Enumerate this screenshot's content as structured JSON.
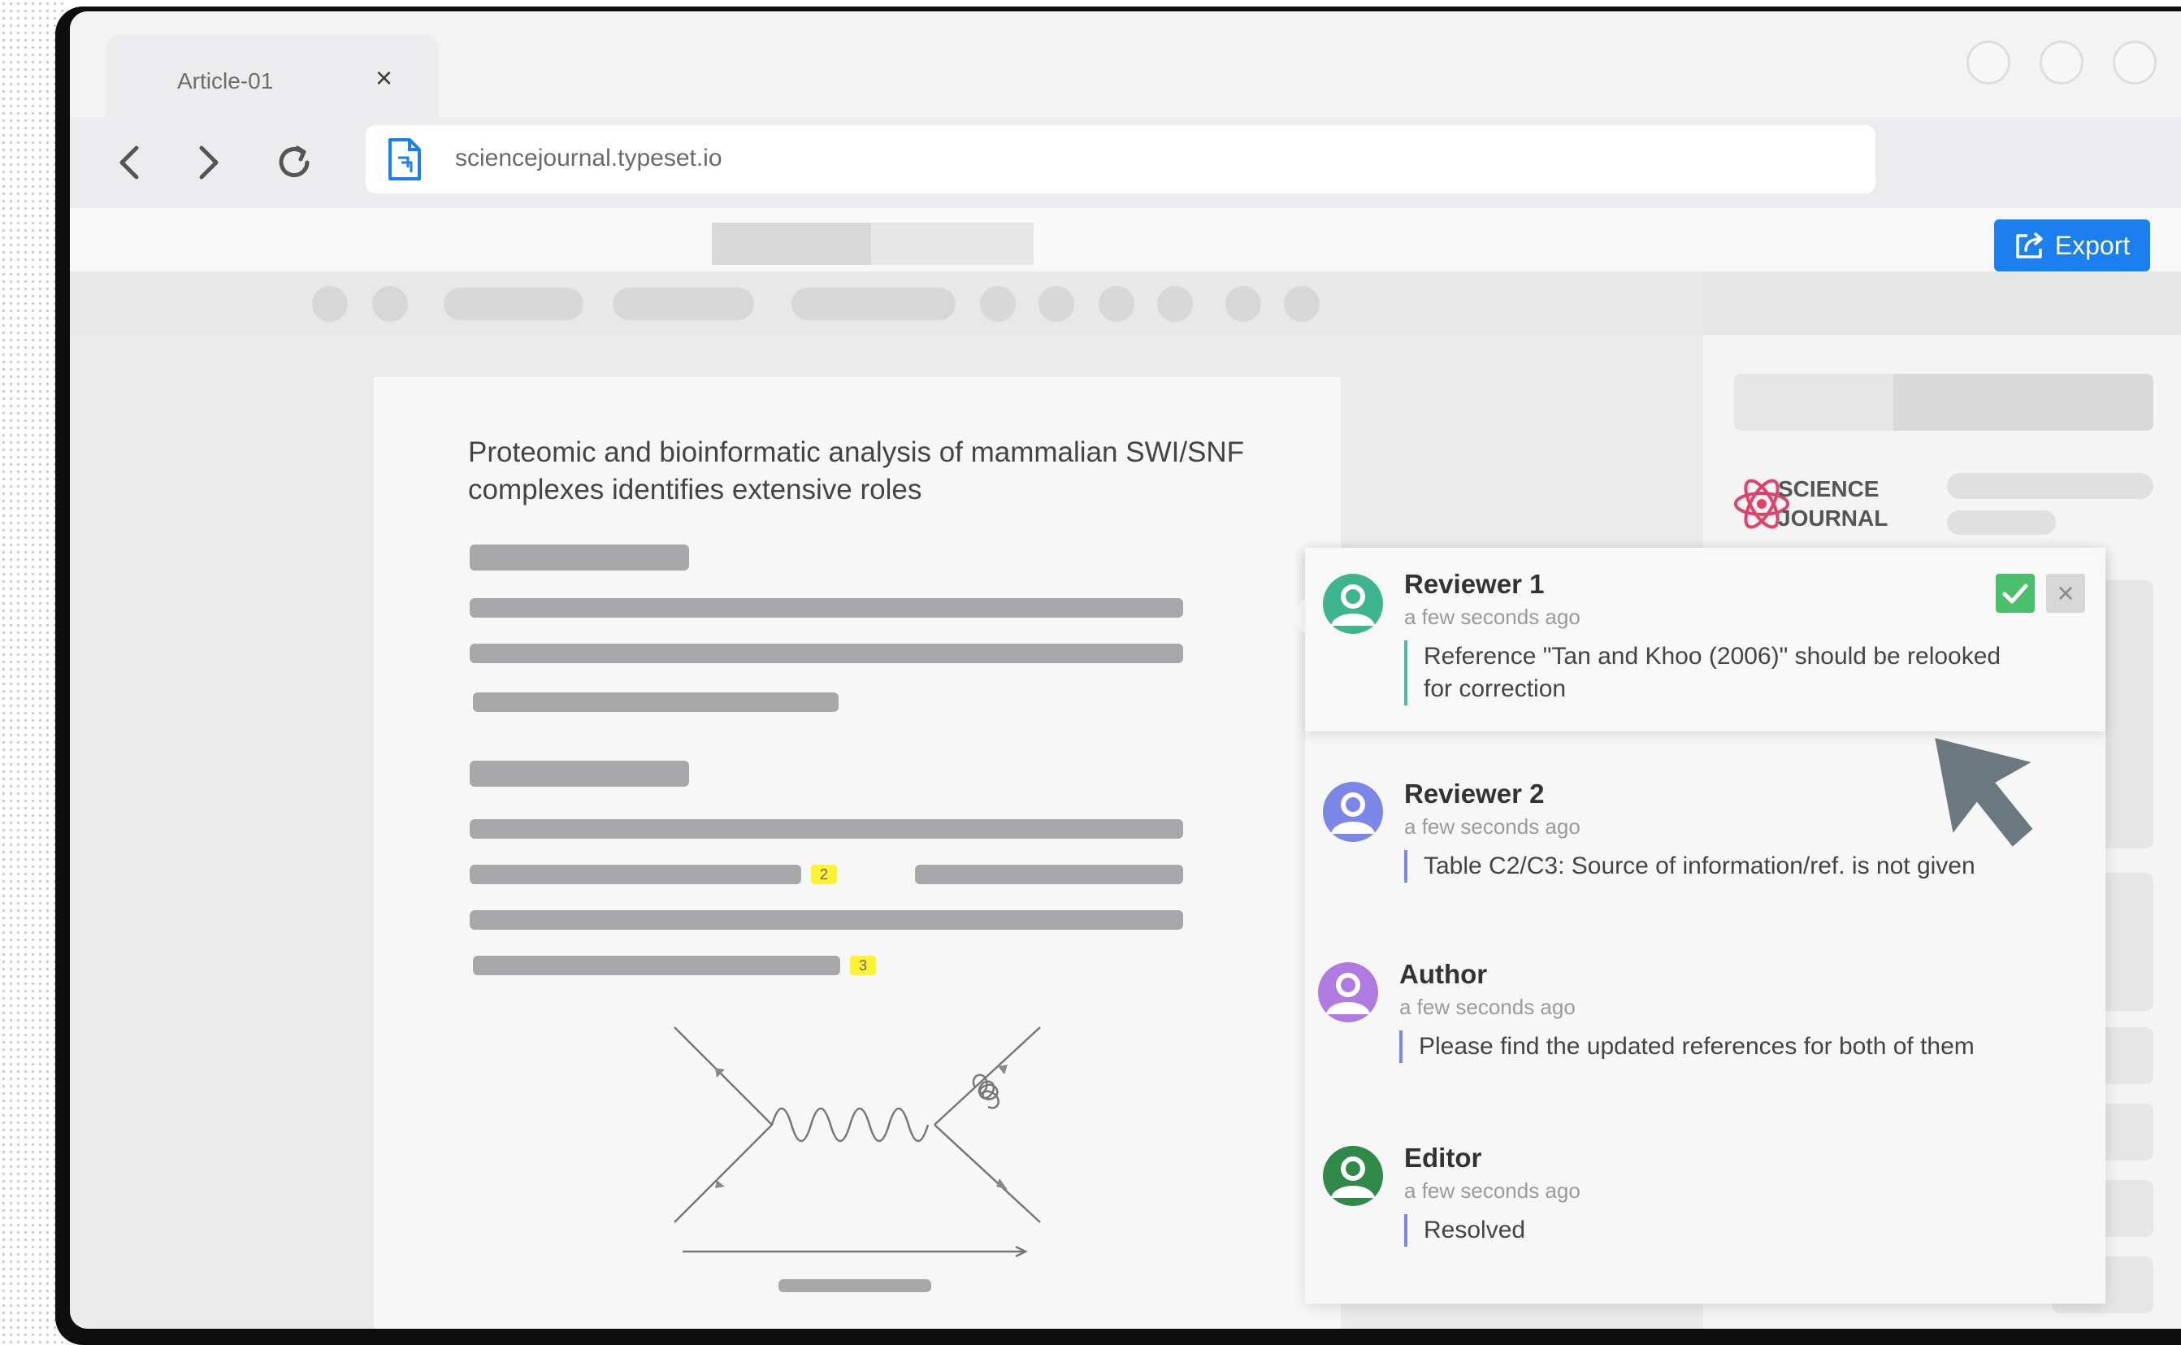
{
  "tab": {
    "title": "Article-01",
    "close_label": "×"
  },
  "url": "sciencejournal.typeset.io",
  "toolbar": {
    "export_label": "Export"
  },
  "journal": {
    "name_line1": "SCIENCE",
    "name_line2": "JOURNAL"
  },
  "document": {
    "title": "Proteomic and bioinformatic analysis of mammalian SWI/SNF complexes identifies extensive roles",
    "citation_badges": [
      "2",
      "3"
    ]
  },
  "comments": [
    {
      "name": "Reviewer 1",
      "time": "a few seconds ago",
      "text": "Reference \"Tan and Khoo (2006)\" should be relooked for correction",
      "avatar_color": "#3fb58f"
    },
    {
      "name": "Reviewer 2",
      "time": "a few seconds ago",
      "text": "Table C2/C3: Source of information/ref. is not given",
      "avatar_color": "#7b86e6"
    },
    {
      "name": "Author",
      "time": "a few seconds ago",
      "text": "Please find the updated references for both of them",
      "avatar_color": "#b07be0"
    },
    {
      "name": "Editor",
      "time": "a few seconds ago",
      "text": "Resolved",
      "avatar_color": "#2f8a4a"
    }
  ],
  "comment_actions": {
    "dismiss_label": "×"
  },
  "colors": {
    "accent": "#1b7ff0",
    "approve": "#4bbf6b"
  }
}
